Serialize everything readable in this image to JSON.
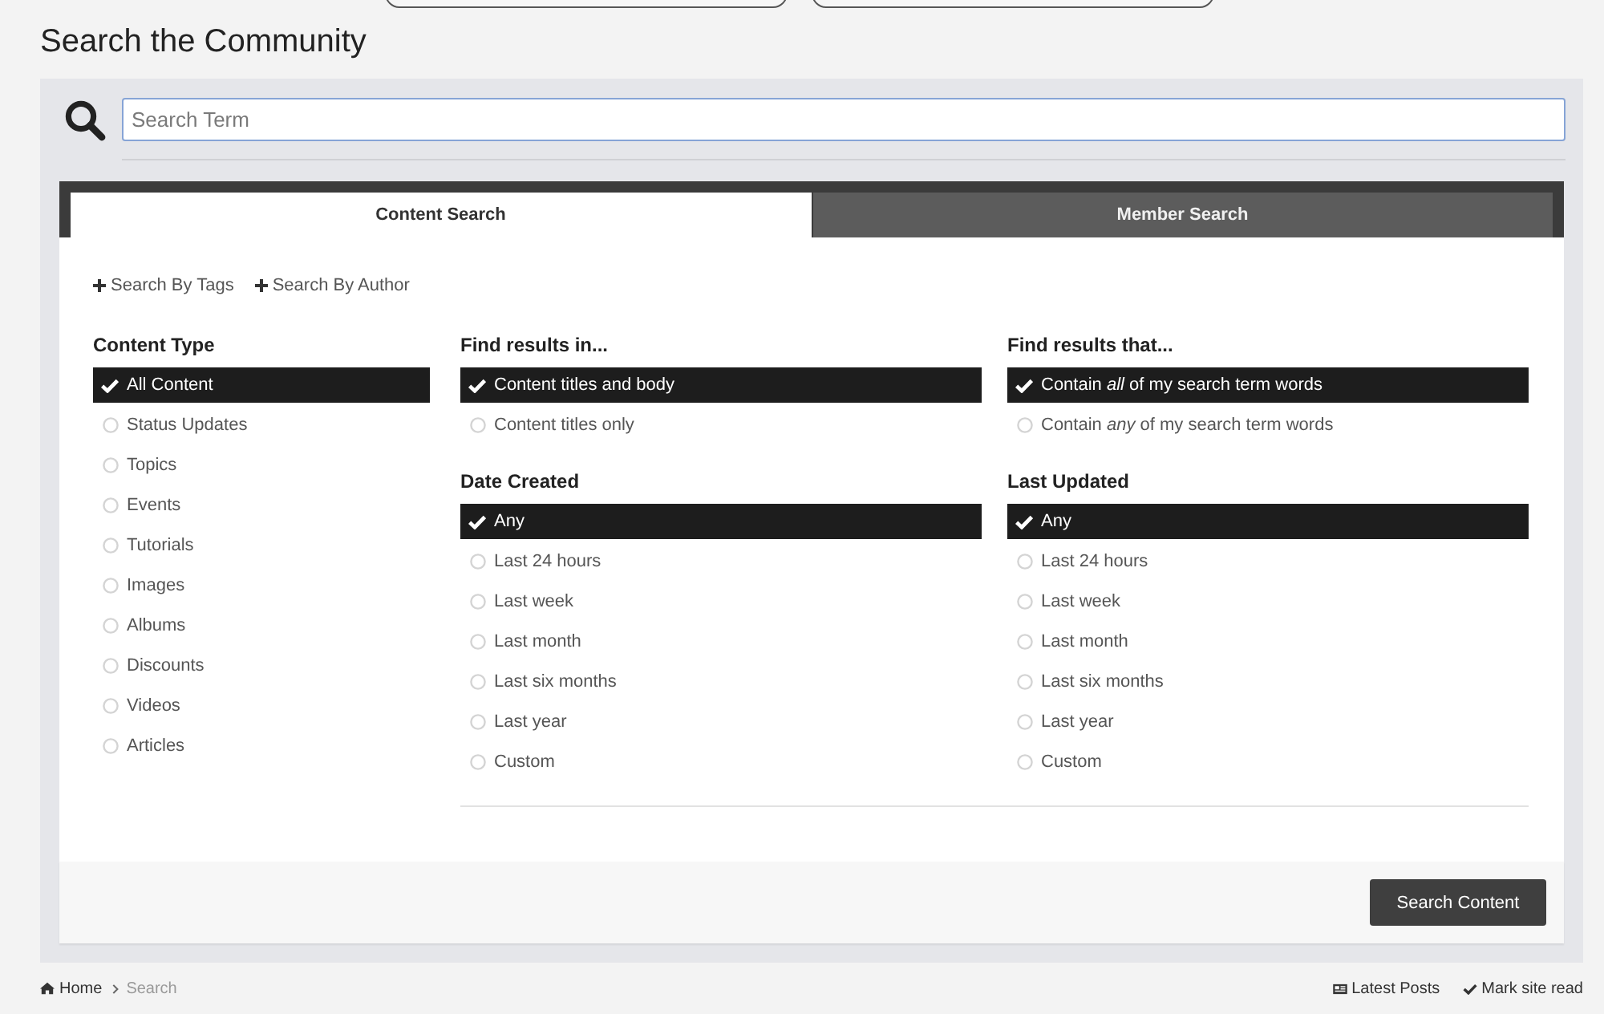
{
  "page_title": "Search the Community",
  "search": {
    "placeholder": "Search Term"
  },
  "tabs": [
    {
      "label": "Content Search",
      "selected": true
    },
    {
      "label": "Member Search",
      "selected": false
    }
  ],
  "filter_links": [
    {
      "label": "Search By Tags"
    },
    {
      "label": "Search By Author"
    }
  ],
  "content_type": {
    "heading": "Content Type",
    "options": [
      {
        "label": "All Content",
        "selected": true
      },
      {
        "label": "Status Updates",
        "selected": false
      },
      {
        "label": "Topics",
        "selected": false
      },
      {
        "label": "Events",
        "selected": false
      },
      {
        "label": "Tutorials",
        "selected": false
      },
      {
        "label": "Images",
        "selected": false
      },
      {
        "label": "Albums",
        "selected": false
      },
      {
        "label": "Discounts",
        "selected": false
      },
      {
        "label": "Videos",
        "selected": false
      },
      {
        "label": "Articles",
        "selected": false
      }
    ]
  },
  "filters": [
    {
      "heading": "Find results in...",
      "options": [
        {
          "label": "Content titles and body",
          "selected": true
        },
        {
          "label": "Content titles only",
          "selected": false
        }
      ]
    },
    {
      "heading": "Find results that...",
      "options": [
        {
          "label": "Contain *all* of my search term words",
          "selected": true
        },
        {
          "label": "Contain *any* of my search term words",
          "selected": false
        }
      ]
    },
    {
      "heading": "Date Created",
      "options": [
        {
          "label": "Any",
          "selected": true
        },
        {
          "label": "Last 24 hours",
          "selected": false
        },
        {
          "label": "Last week",
          "selected": false
        },
        {
          "label": "Last month",
          "selected": false
        },
        {
          "label": "Last six months",
          "selected": false
        },
        {
          "label": "Last year",
          "selected": false
        },
        {
          "label": "Custom",
          "selected": false
        }
      ]
    },
    {
      "heading": "Last Updated",
      "options": [
        {
          "label": "Any",
          "selected": true
        },
        {
          "label": "Last 24 hours",
          "selected": false
        },
        {
          "label": "Last week",
          "selected": false
        },
        {
          "label": "Last month",
          "selected": false
        },
        {
          "label": "Last six months",
          "selected": false
        },
        {
          "label": "Last year",
          "selected": false
        },
        {
          "label": "Custom",
          "selected": false
        }
      ]
    }
  ],
  "submit_button": {
    "label": "Search Content"
  },
  "breadcrumb": [
    {
      "label": "Home",
      "current": false
    },
    {
      "label": "Search",
      "current": true
    }
  ],
  "footer_links": [
    {
      "label": "Latest Posts"
    },
    {
      "label": "Mark site read"
    }
  ]
}
